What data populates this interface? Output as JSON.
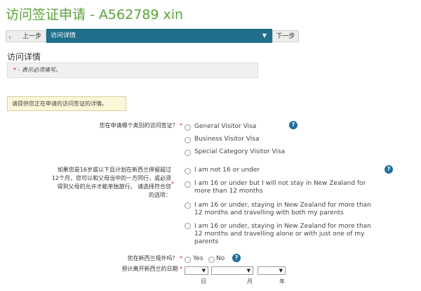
{
  "page": {
    "title": "访问签证申请 - A562789 xin"
  },
  "nav": {
    "prev_label": "上一步",
    "prev_arrow": "‹",
    "current_step": "访问详情",
    "caret": "▼",
    "next_label": "下一步"
  },
  "section": {
    "title": "访问详情",
    "required_star": "*",
    "required_note": " - 表示必须填写。"
  },
  "info": {
    "text": "请提供您正在申请的访问签证的详情。"
  },
  "q_visa": {
    "label": "您在申请哪个类别的访问签证？",
    "required": "*",
    "options": [
      "General Visitor Visa",
      "Business Visitor Visa",
      "Special Category Visitor Visa"
    ]
  },
  "q_age": {
    "label_lines": [
      "如果您是16岁或以下且计划在新西兰停留超过",
      "12个月，您可以和父母当中的一方同行，或必须",
      "得到父母的允许才能单独旅行。 请选择符合您",
      "的选项："
    ],
    "required": "*",
    "options": [
      [
        "I am not 16 or under"
      ],
      [
        "I am 16 or under but I will not stay in New Zealand for",
        "more than 12 months"
      ],
      [
        "I am 16 or under, staying in New Zealand for more than",
        "12 months and travelling with both my parents"
      ],
      [
        "I am 16 or under, staying in New Zealand for more than",
        "12 months and travelling alone or with just one of my",
        "parents"
      ]
    ]
  },
  "q_outside": {
    "label": "您在新西兰境外吗？",
    "required": "*",
    "yes": "Yes",
    "no": "No"
  },
  "q_depart": {
    "label": "预计离开新西兰的日期",
    "required": "*",
    "day": "日",
    "month": "月",
    "year": "年"
  },
  "icons": {
    "help": "?"
  }
}
